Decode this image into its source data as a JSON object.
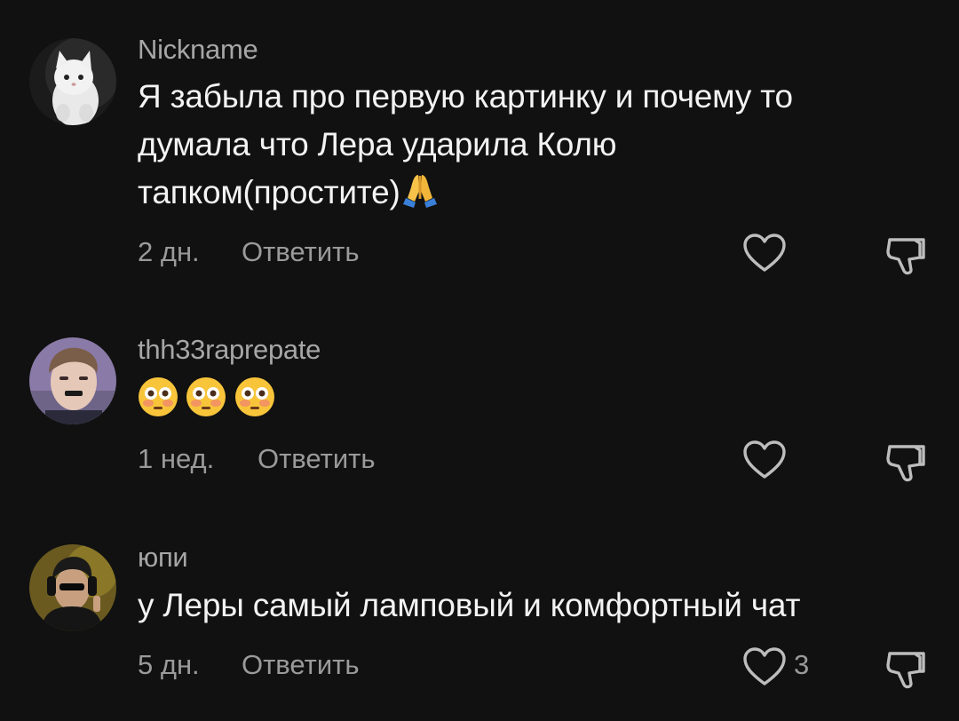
{
  "comments": [
    {
      "author": "Nickname",
      "text_lines": [
        "Я забыла про первую картинку и почему то",
        "думала что Лера ударила Колю",
        "тапком(простите)"
      ],
      "trailing_emoji": "pray-emoji",
      "time": "2 дн.",
      "reply_label": "Ответить",
      "like_count": "",
      "avatar": "white-kitten-avatar"
    },
    {
      "author": "thh33raprepate",
      "emojis": [
        "flushed-face-emoji",
        "flushed-face-emoji",
        "flushed-face-emoji"
      ],
      "time": "1 нед.",
      "reply_label": "Ответить",
      "like_count": "",
      "avatar": "person-photo-avatar"
    },
    {
      "author": "юпи",
      "text_lines": [
        "у Леры самый ламповый и комфортный чат"
      ],
      "time": "5 дн.",
      "reply_label": "Ответить",
      "like_count": "3",
      "avatar": "person-headphones-avatar"
    }
  ],
  "icons": {
    "like": "heart-outline-icon",
    "dislike": "thumbs-down-outline-icon"
  },
  "colors": {
    "background": "#111111",
    "primary_text": "#f3f3f3",
    "secondary_text": "#9a9a9a"
  }
}
